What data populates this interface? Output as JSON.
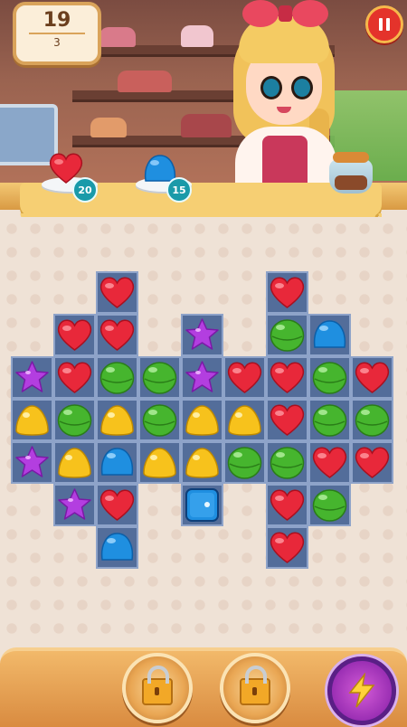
{
  "hud": {
    "moves_left": "19",
    "level": "3",
    "pause_icon": "pause-icon"
  },
  "goals": [
    {
      "candy": "red-heart",
      "count": "20"
    },
    {
      "candy": "blue-gumdrop",
      "count": "15"
    }
  ],
  "colors": {
    "red": "#e8283a",
    "green": "#46b52e",
    "yellow": "#f7c21c",
    "blue": "#1f8fe0",
    "purple": "#b33ee0",
    "tile": "#536d9a"
  },
  "board": {
    "rows": [
      [
        null,
        null,
        "R",
        null,
        null,
        null,
        "R",
        null,
        null
      ],
      [
        null,
        "R",
        "R",
        null,
        "P",
        null,
        "G",
        "B",
        null
      ],
      [
        "P",
        "R",
        "G",
        "G",
        "P",
        "R",
        "R",
        "G",
        "R"
      ],
      [
        "Y",
        "G",
        "Y",
        "G",
        "Y",
        "Y",
        "R",
        "G",
        "G"
      ],
      [
        "P",
        "Y",
        "B",
        "Y",
        "Y",
        "G",
        "G",
        "R",
        "R"
      ],
      [
        null,
        "P",
        "R",
        null,
        "X",
        null,
        "R",
        "G",
        null
      ],
      [
        null,
        null,
        "B",
        null,
        null,
        null,
        "R",
        null,
        null
      ]
    ],
    "legend": {
      "R": "red-heart",
      "G": "green-round",
      "Y": "yellow-drop",
      "B": "blue-gumdrop",
      "P": "purple-star",
      "X": "blue-ice-cube"
    }
  },
  "boosters": [
    {
      "name": "locked-booster-1",
      "icon": "lock-icon"
    },
    {
      "name": "locked-booster-2",
      "icon": "lock-icon"
    },
    {
      "name": "lightning-booster",
      "icon": "lightning-icon"
    }
  ]
}
